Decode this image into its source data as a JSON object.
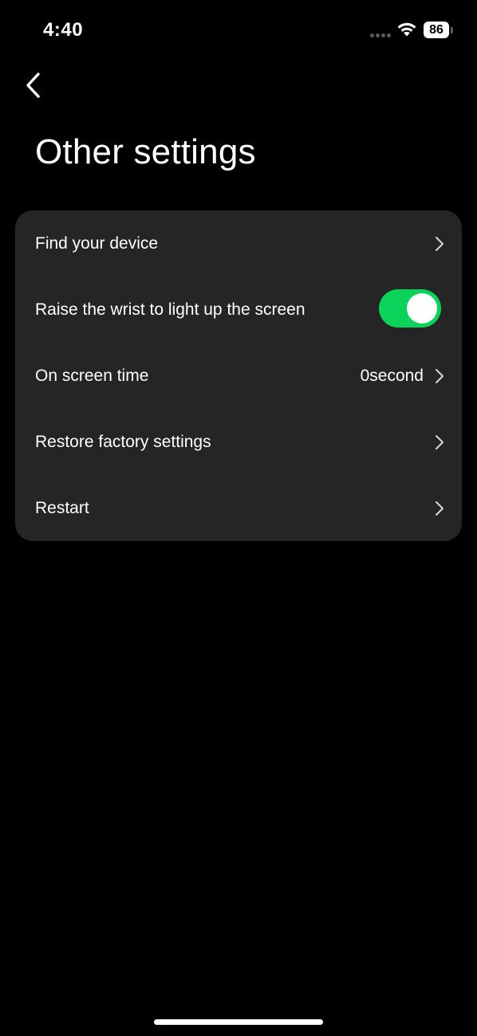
{
  "status_bar": {
    "time": "4:40",
    "battery": "86"
  },
  "header": {
    "title": "Other settings"
  },
  "settings": {
    "find_device": {
      "label": "Find your device"
    },
    "raise_wrist": {
      "label": "Raise the wrist to light up the screen",
      "enabled": true
    },
    "on_screen_time": {
      "label": "On screen time",
      "value": "0second"
    },
    "restore_factory": {
      "label": "Restore factory settings"
    },
    "restart": {
      "label": "Restart"
    }
  },
  "colors": {
    "background": "#000000",
    "card": "#252525",
    "toggle_on": "#0bd35a",
    "text": "#ffffff"
  }
}
